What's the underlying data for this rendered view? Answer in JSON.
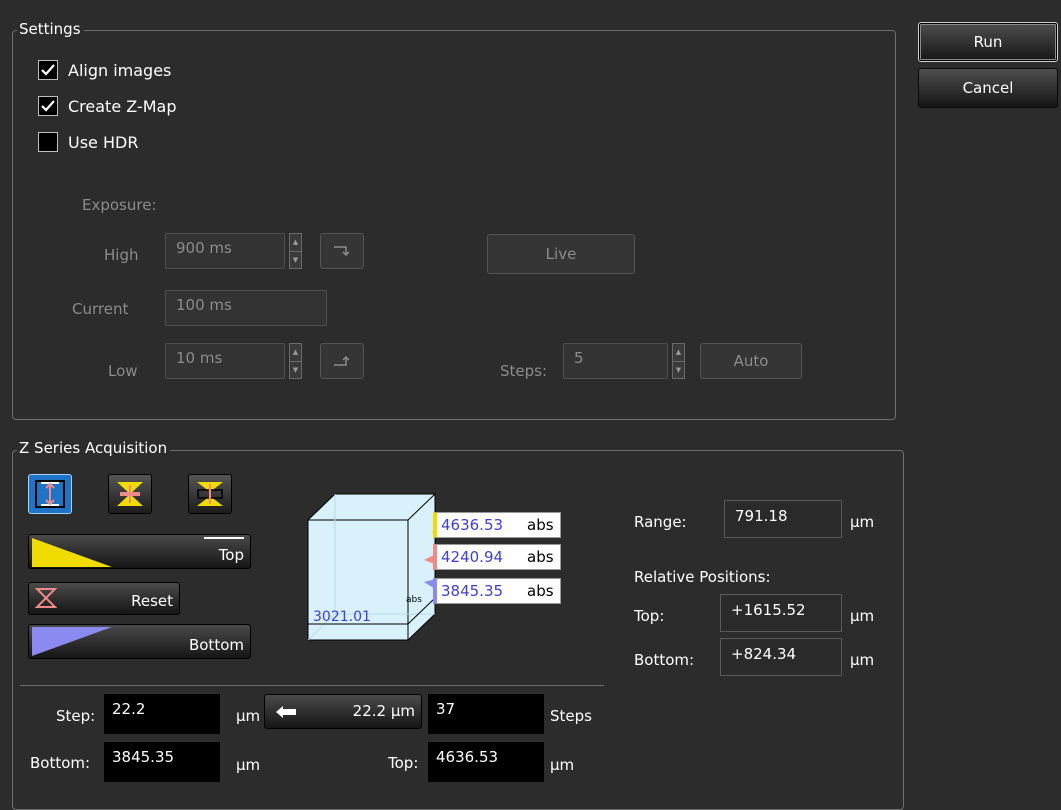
{
  "actions": {
    "run_label": "Run",
    "cancel_label": "Cancel"
  },
  "settings": {
    "title": "Settings",
    "align_images": {
      "label": "Align images",
      "checked": true
    },
    "create_zmap": {
      "label": "Create Z-Map",
      "checked": true
    },
    "use_hdr": {
      "label": "Use HDR",
      "checked": false
    },
    "exposure_label": "Exposure:",
    "high": {
      "label": "High",
      "value": "900 ms"
    },
    "current": {
      "label": "Current",
      "value": "100 ms"
    },
    "low": {
      "label": "Low",
      "value": "10 ms"
    },
    "live_label": "Live",
    "steps": {
      "label": "Steps:",
      "value": "5",
      "auto_label": "Auto"
    }
  },
  "zseries": {
    "title": "Z Series Acquisition",
    "top_label": "Top",
    "reset_label": "Reset",
    "bottom_label": "Bottom",
    "diagram": {
      "top_value": "4636.53",
      "mid_value": "4240.94",
      "bottom_value": "3845.35",
      "abs_label": "abs",
      "base_value": "3021.01",
      "base_abs_label": "abs"
    },
    "range": {
      "label": "Range:",
      "value": "791.18",
      "unit": "µm"
    },
    "relative_label": "Relative Positions:",
    "rel_top": {
      "label": "Top:",
      "value": "+1615.52",
      "unit": "µm"
    },
    "rel_bottom": {
      "label": "Bottom:",
      "value": "+824.34",
      "unit": "µm"
    },
    "step": {
      "label": "Step:",
      "value": "22.2",
      "unit": "µm"
    },
    "step_button_label": "22.2 µm",
    "steps_count": {
      "value": "37",
      "label": "Steps"
    },
    "bottom": {
      "label": "Bottom:",
      "value": "3845.35",
      "unit": "µm"
    },
    "top": {
      "label": "Top:",
      "value": "4636.53",
      "unit": "µm"
    }
  },
  "colors": {
    "top_marker": "#f0dc00",
    "mid_marker": "#f08a8a",
    "bottom_marker": "#8a8af0",
    "active_blue": "#1e74c6"
  }
}
